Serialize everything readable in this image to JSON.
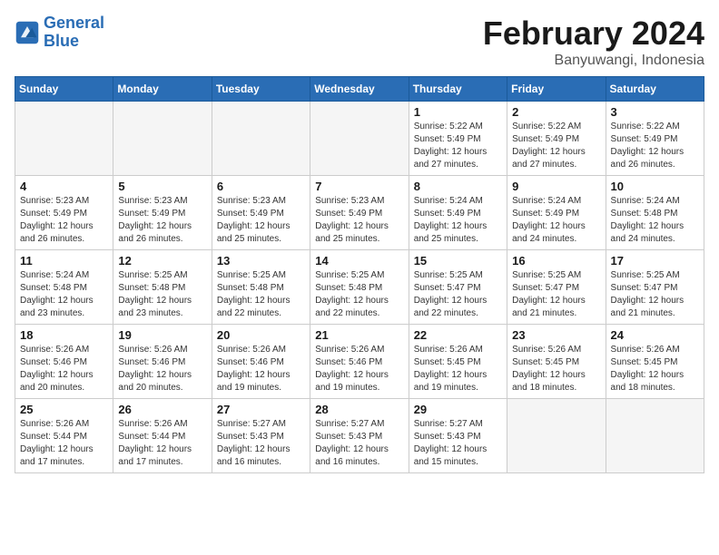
{
  "header": {
    "logo_line1": "General",
    "logo_line2": "Blue",
    "month": "February 2024",
    "location": "Banyuwangi, Indonesia"
  },
  "days_of_week": [
    "Sunday",
    "Monday",
    "Tuesday",
    "Wednesday",
    "Thursday",
    "Friday",
    "Saturday"
  ],
  "weeks": [
    [
      {
        "day": "",
        "info": ""
      },
      {
        "day": "",
        "info": ""
      },
      {
        "day": "",
        "info": ""
      },
      {
        "day": "",
        "info": ""
      },
      {
        "day": "1",
        "info": "Sunrise: 5:22 AM\nSunset: 5:49 PM\nDaylight: 12 hours\nand 27 minutes."
      },
      {
        "day": "2",
        "info": "Sunrise: 5:22 AM\nSunset: 5:49 PM\nDaylight: 12 hours\nand 27 minutes."
      },
      {
        "day": "3",
        "info": "Sunrise: 5:22 AM\nSunset: 5:49 PM\nDaylight: 12 hours\nand 26 minutes."
      }
    ],
    [
      {
        "day": "4",
        "info": "Sunrise: 5:23 AM\nSunset: 5:49 PM\nDaylight: 12 hours\nand 26 minutes."
      },
      {
        "day": "5",
        "info": "Sunrise: 5:23 AM\nSunset: 5:49 PM\nDaylight: 12 hours\nand 26 minutes."
      },
      {
        "day": "6",
        "info": "Sunrise: 5:23 AM\nSunset: 5:49 PM\nDaylight: 12 hours\nand 25 minutes."
      },
      {
        "day": "7",
        "info": "Sunrise: 5:23 AM\nSunset: 5:49 PM\nDaylight: 12 hours\nand 25 minutes."
      },
      {
        "day": "8",
        "info": "Sunrise: 5:24 AM\nSunset: 5:49 PM\nDaylight: 12 hours\nand 25 minutes."
      },
      {
        "day": "9",
        "info": "Sunrise: 5:24 AM\nSunset: 5:49 PM\nDaylight: 12 hours\nand 24 minutes."
      },
      {
        "day": "10",
        "info": "Sunrise: 5:24 AM\nSunset: 5:48 PM\nDaylight: 12 hours\nand 24 minutes."
      }
    ],
    [
      {
        "day": "11",
        "info": "Sunrise: 5:24 AM\nSunset: 5:48 PM\nDaylight: 12 hours\nand 23 minutes."
      },
      {
        "day": "12",
        "info": "Sunrise: 5:25 AM\nSunset: 5:48 PM\nDaylight: 12 hours\nand 23 minutes."
      },
      {
        "day": "13",
        "info": "Sunrise: 5:25 AM\nSunset: 5:48 PM\nDaylight: 12 hours\nand 22 minutes."
      },
      {
        "day": "14",
        "info": "Sunrise: 5:25 AM\nSunset: 5:48 PM\nDaylight: 12 hours\nand 22 minutes."
      },
      {
        "day": "15",
        "info": "Sunrise: 5:25 AM\nSunset: 5:47 PM\nDaylight: 12 hours\nand 22 minutes."
      },
      {
        "day": "16",
        "info": "Sunrise: 5:25 AM\nSunset: 5:47 PM\nDaylight: 12 hours\nand 21 minutes."
      },
      {
        "day": "17",
        "info": "Sunrise: 5:25 AM\nSunset: 5:47 PM\nDaylight: 12 hours\nand 21 minutes."
      }
    ],
    [
      {
        "day": "18",
        "info": "Sunrise: 5:26 AM\nSunset: 5:46 PM\nDaylight: 12 hours\nand 20 minutes."
      },
      {
        "day": "19",
        "info": "Sunrise: 5:26 AM\nSunset: 5:46 PM\nDaylight: 12 hours\nand 20 minutes."
      },
      {
        "day": "20",
        "info": "Sunrise: 5:26 AM\nSunset: 5:46 PM\nDaylight: 12 hours\nand 19 minutes."
      },
      {
        "day": "21",
        "info": "Sunrise: 5:26 AM\nSunset: 5:46 PM\nDaylight: 12 hours\nand 19 minutes."
      },
      {
        "day": "22",
        "info": "Sunrise: 5:26 AM\nSunset: 5:45 PM\nDaylight: 12 hours\nand 19 minutes."
      },
      {
        "day": "23",
        "info": "Sunrise: 5:26 AM\nSunset: 5:45 PM\nDaylight: 12 hours\nand 18 minutes."
      },
      {
        "day": "24",
        "info": "Sunrise: 5:26 AM\nSunset: 5:45 PM\nDaylight: 12 hours\nand 18 minutes."
      }
    ],
    [
      {
        "day": "25",
        "info": "Sunrise: 5:26 AM\nSunset: 5:44 PM\nDaylight: 12 hours\nand 17 minutes."
      },
      {
        "day": "26",
        "info": "Sunrise: 5:26 AM\nSunset: 5:44 PM\nDaylight: 12 hours\nand 17 minutes."
      },
      {
        "day": "27",
        "info": "Sunrise: 5:27 AM\nSunset: 5:43 PM\nDaylight: 12 hours\nand 16 minutes."
      },
      {
        "day": "28",
        "info": "Sunrise: 5:27 AM\nSunset: 5:43 PM\nDaylight: 12 hours\nand 16 minutes."
      },
      {
        "day": "29",
        "info": "Sunrise: 5:27 AM\nSunset: 5:43 PM\nDaylight: 12 hours\nand 15 minutes."
      },
      {
        "day": "",
        "info": ""
      },
      {
        "day": "",
        "info": ""
      }
    ]
  ]
}
